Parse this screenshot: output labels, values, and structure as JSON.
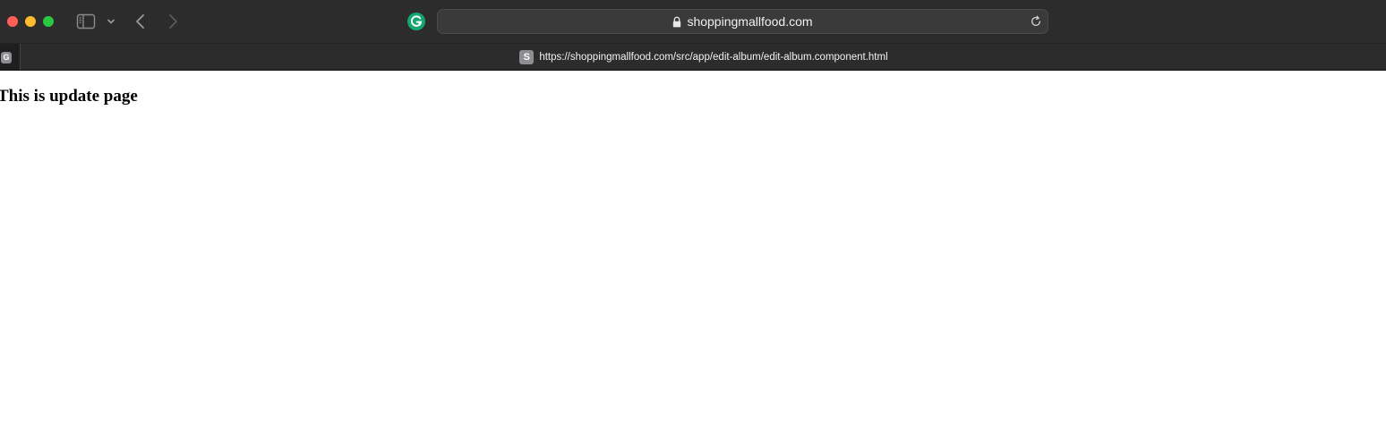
{
  "colors": {
    "chrome_bg": "#2c2c2c",
    "address_bar_bg": "#3a3a3a",
    "traffic_close": "#ff5f57",
    "traffic_minimize": "#febc2e",
    "traffic_maximize": "#28c840",
    "grammarly": "#15a66f",
    "favicon_bg": "#8d8d92",
    "page_bg": "#ffffff"
  },
  "toolbar": {
    "icons": [
      "sidebar-icon",
      "chevron-down-icon",
      "back-arrow-icon",
      "forward-arrow-icon",
      "grammarly-icon",
      "lock-icon",
      "reload-icon"
    ],
    "address_text": "shoppingmallfood.com"
  },
  "tabs": {
    "pinned_favicon_letter": "G",
    "active": {
      "favicon_letter": "S",
      "title": "https://shoppingmallfood.com/src/app/edit-album/edit-album.component.html"
    }
  },
  "page": {
    "heading": "This is update page"
  }
}
